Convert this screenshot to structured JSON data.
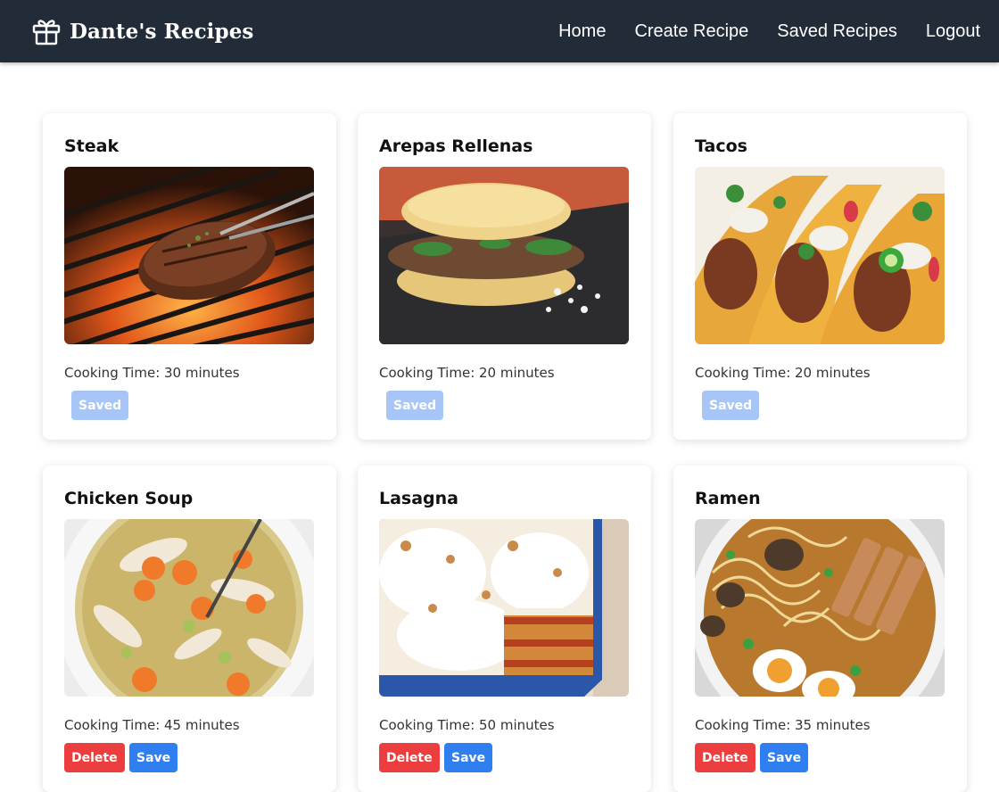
{
  "header": {
    "brand_title": "Dante's Recipes",
    "brand_icon": "gift-icon",
    "nav": [
      {
        "label": "Home"
      },
      {
        "label": "Create Recipe"
      },
      {
        "label": "Saved Recipes"
      },
      {
        "label": "Logout"
      }
    ]
  },
  "recipes": [
    {
      "title": "Steak",
      "cooking_time": "Cooking Time: 30 minutes",
      "saved_label": "Saved"
    },
    {
      "title": "Arepas Rellenas",
      "cooking_time": "Cooking Time: 20 minutes",
      "saved_label": "Saved"
    },
    {
      "title": "Tacos",
      "cooking_time": "Cooking Time: 20 minutes",
      "saved_label": "Saved"
    },
    {
      "title": "Chicken Soup",
      "cooking_time": "Cooking Time: 45 minutes",
      "delete_label": "Delete",
      "save_label": "Save"
    },
    {
      "title": "Lasagna",
      "cooking_time": "Cooking Time: 50 minutes",
      "delete_label": "Delete",
      "save_label": "Save"
    },
    {
      "title": "Ramen",
      "cooking_time": "Cooking Time: 35 minutes",
      "delete_label": "Delete",
      "save_label": "Save"
    }
  ],
  "colors": {
    "navbar": "#222b38",
    "saved_button": "#a8c5f7",
    "delete_button": "#ec3e3e",
    "save_button": "#2f7ff0"
  }
}
